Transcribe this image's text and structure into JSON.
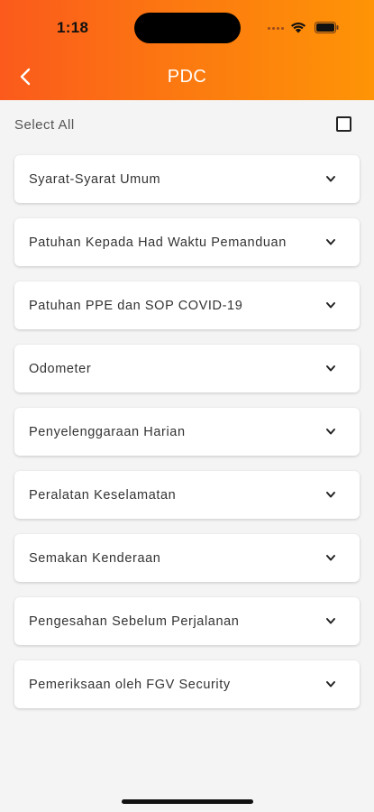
{
  "status": {
    "time": "1:18"
  },
  "header": {
    "title": "PDC"
  },
  "select_all": {
    "label": "Select All"
  },
  "sections": [
    {
      "label": "Syarat-Syarat Umum"
    },
    {
      "label": "Patuhan Kepada Had Waktu Pemanduan"
    },
    {
      "label": "Patuhan PPE dan SOP COVID-19"
    },
    {
      "label": "Odometer"
    },
    {
      "label": "Penyelenggaraan Harian"
    },
    {
      "label": "Peralatan Keselamatan"
    },
    {
      "label": "Semakan Kenderaan"
    },
    {
      "label": "Pengesahan Sebelum Perjalanan"
    },
    {
      "label": "Pemeriksaan oleh FGV Security"
    }
  ],
  "colors": {
    "header_start": "#fb5a1c",
    "header_end": "#fe9406",
    "background": "#f4f4f4"
  },
  "icons": {
    "back": "chevron-left-icon",
    "expand": "chevron-down-icon",
    "checkbox": "checkbox-unchecked"
  }
}
